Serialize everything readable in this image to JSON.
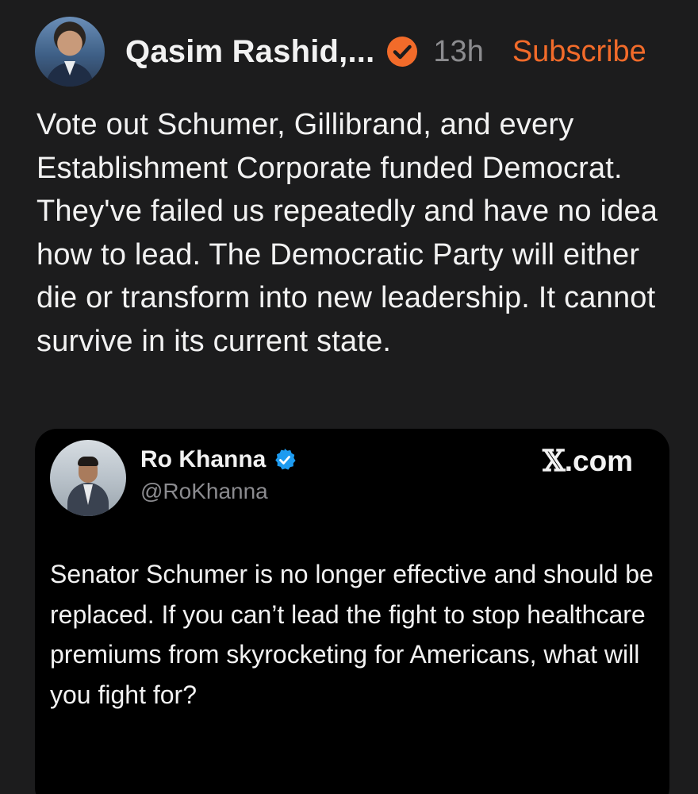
{
  "post": {
    "author_name": "Qasim Rashid,...",
    "timestamp": "13h",
    "subscribe_label": "Subscribe",
    "body": "Vote out Schumer, Gillibrand, and every Establishment Corporate funded Democrat. They've failed us repeatedly and have no idea how to lead. The Democratic Party will either die or transform into new leadership. It cannot survive in its current state.",
    "badge_color": "#f26b2a",
    "accent_color": "#f26b2a"
  },
  "embed": {
    "name": "Ro Khanna",
    "handle": "@RoKhanna",
    "source_mark": "𝕏",
    "source_suffix": ".com",
    "text": "Senator Schumer is no longer effective and should be replaced. If you can’t lead the fight to stop healthcare premiums from skyrocketing for Americans, what will you fight for?",
    "badge_color": "#1d9bf0"
  },
  "icons": {
    "post_verified": "verified-check-icon",
    "embed_verified": "verified-check-icon"
  }
}
